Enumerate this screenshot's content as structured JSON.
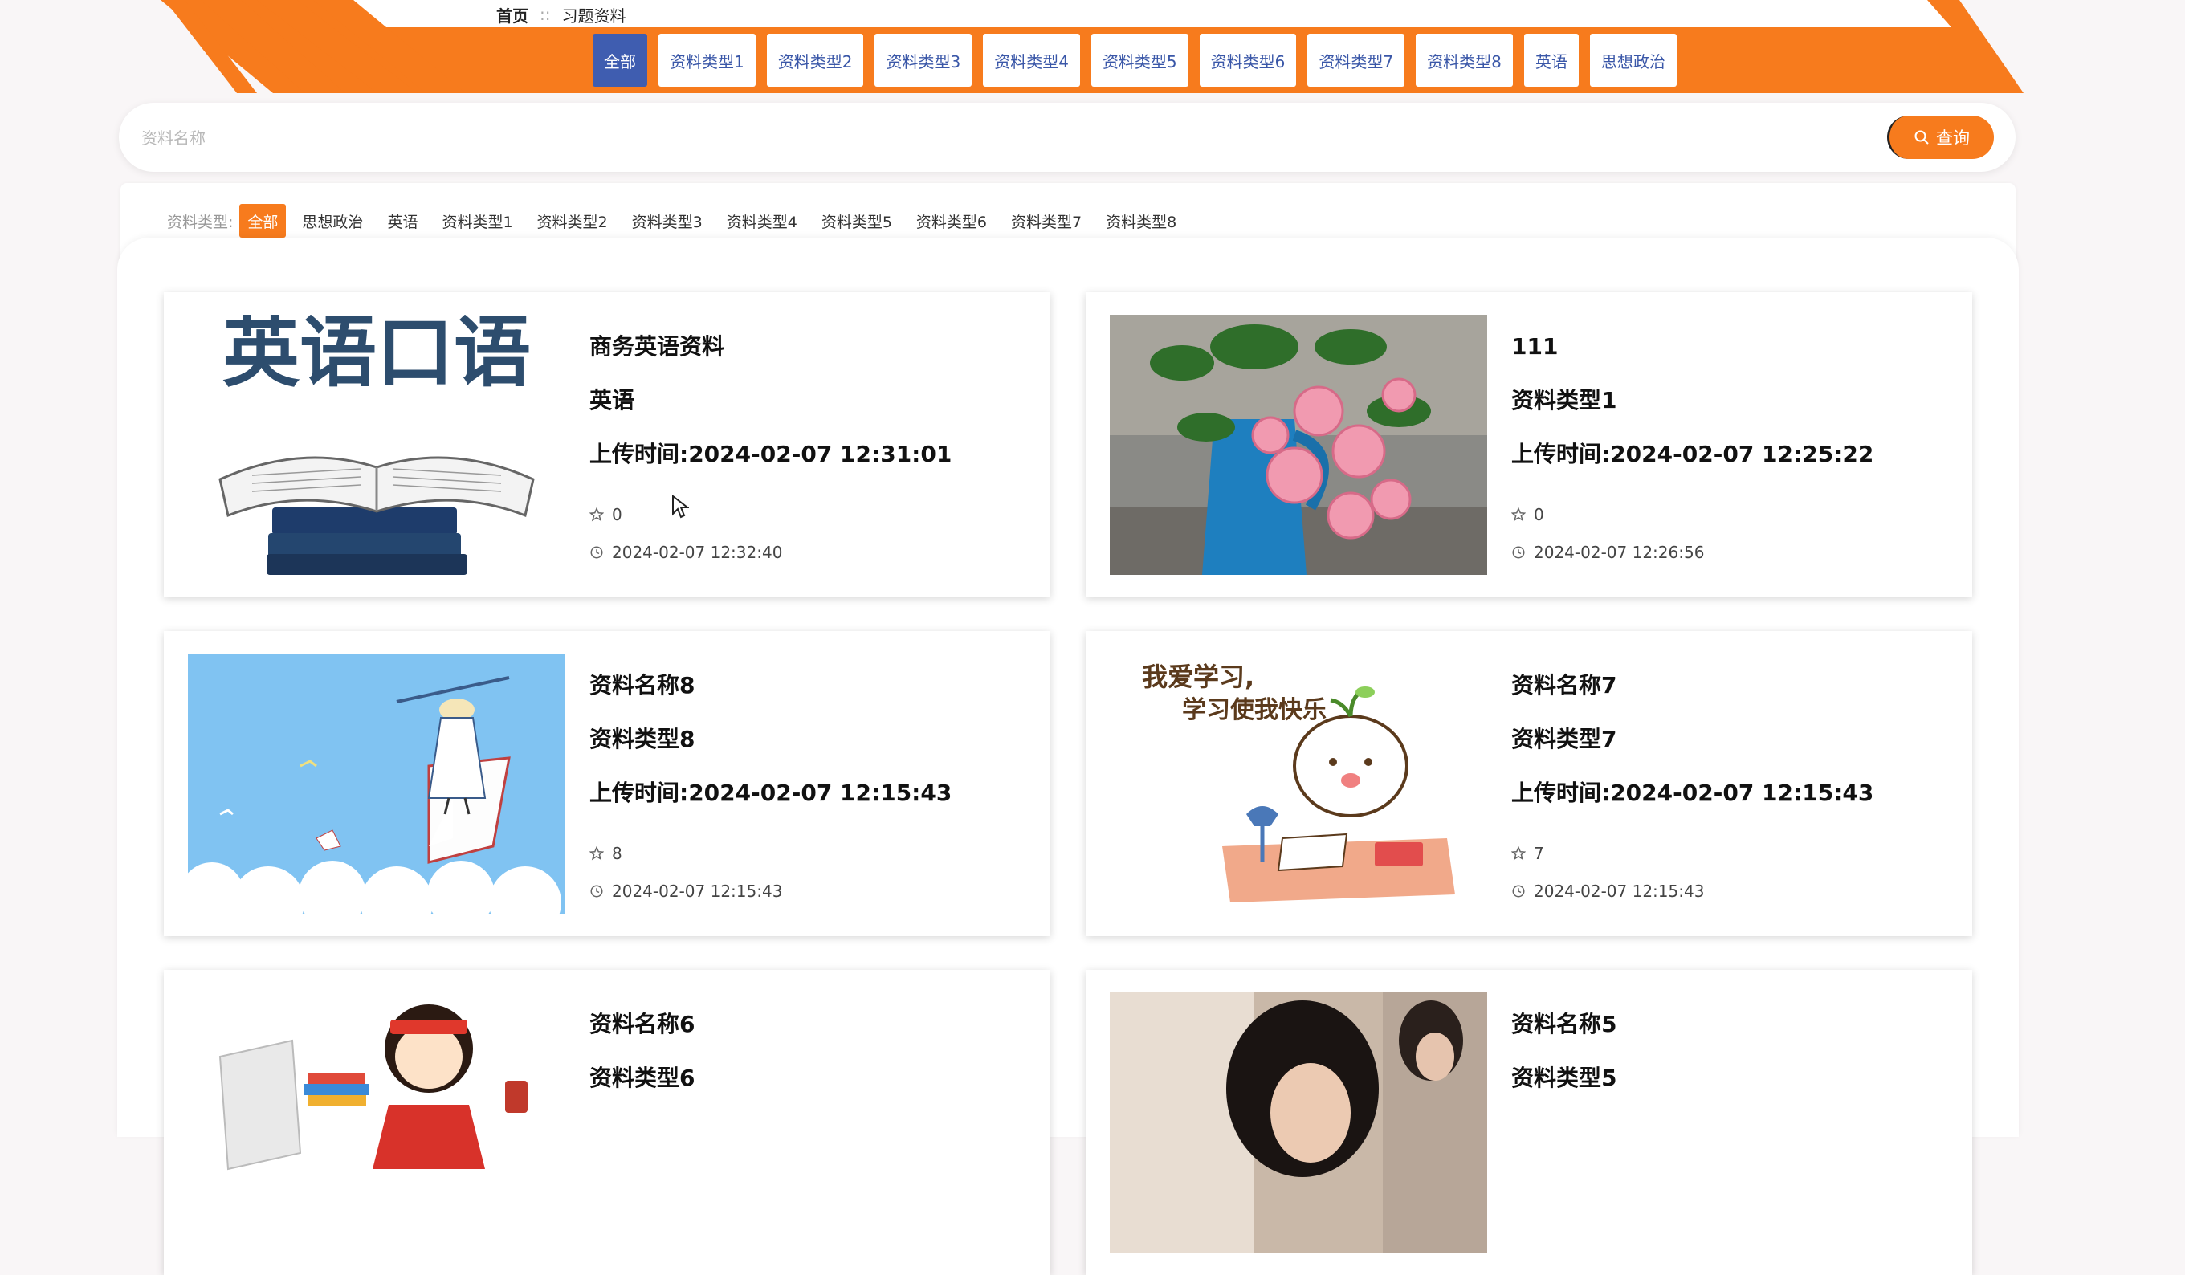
{
  "breadcrumb": {
    "home": "首页",
    "separator": "::",
    "current": "习题资料"
  },
  "nav": {
    "active_index": 0,
    "items": [
      "全部",
      "资料类型1",
      "资料类型2",
      "资料类型3",
      "资料类型4",
      "资料类型5",
      "资料类型6",
      "资料类型7",
      "资料类型8",
      "英语",
      "思想政治"
    ]
  },
  "search": {
    "placeholder": "资料名称",
    "value": "",
    "button_label": "查询"
  },
  "filter": {
    "label": "资料类型:",
    "active_index": 0,
    "chips": [
      "全部",
      "思想政治",
      "英语",
      "资料类型1",
      "资料类型2",
      "资料类型3",
      "资料类型4",
      "资料类型5",
      "资料类型6",
      "资料类型7",
      "资料类型8"
    ]
  },
  "upload_prefix": "上传时间:",
  "cards": [
    {
      "title": "商务英语资料",
      "type": "英语",
      "upload_time": "2024-02-07 12:31:01",
      "likes": "0",
      "timestamp": "2024-02-07 12:32:40",
      "image": "book-english",
      "image_text": "英语口语"
    },
    {
      "title": "111",
      "type": "资料类型1",
      "upload_time": "2024-02-07 12:25:22",
      "likes": "0",
      "timestamp": "2024-02-07 12:26:56",
      "image": "roses-vase"
    },
    {
      "title": "资料名称8",
      "type": "资料类型8",
      "upload_time": "2024-02-07 12:15:43",
      "likes": "8",
      "timestamp": "2024-02-07 12:15:43",
      "image": "girl-on-book"
    },
    {
      "title": "资料名称7",
      "type": "资料类型7",
      "upload_time": "2024-02-07 12:15:43",
      "likes": "7",
      "timestamp": "2024-02-07 12:15:43",
      "image": "cartoon-study",
      "image_text": [
        "我爱学习,",
        "学习使我快乐"
      ]
    },
    {
      "title": "资料名称6",
      "type": "资料类型6",
      "upload_time": "",
      "likes": "",
      "timestamp": "",
      "image": "cartoon-girl-books"
    },
    {
      "title": "资料名称5",
      "type": "资料类型5",
      "upload_time": "",
      "likes": "",
      "timestamp": "",
      "image": "student-photo"
    }
  ],
  "colors": {
    "accent": "#f77b1d",
    "nav_active": "#3f5db0",
    "nav_text": "#3a57a8"
  }
}
